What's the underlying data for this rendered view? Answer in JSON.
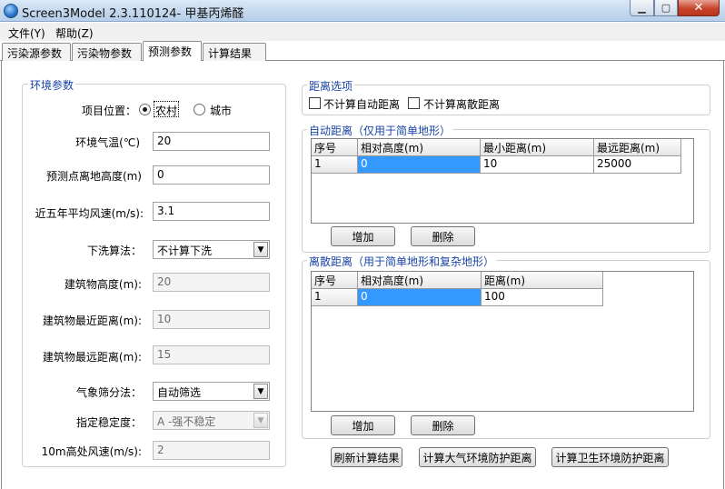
{
  "window": {
    "title": "Screen3Model 2.3.110124- 甲基丙烯醛",
    "min_glyph": "▁",
    "max_glyph": "▢",
    "close_glyph": "✕",
    "app_icon": "app-globe-icon"
  },
  "menu": {
    "file": "文件(Y)",
    "help": "帮助(Z)"
  },
  "tabs": [
    {
      "label": "污染源参数"
    },
    {
      "label": "污染物参数"
    },
    {
      "label": "预测参数",
      "active": true
    },
    {
      "label": "计算结果"
    }
  ],
  "env": {
    "group_title": "环境参数",
    "location_label": "项目位置：",
    "rural": "农村",
    "urban": "城市",
    "temp_label": "环境气温(℃)",
    "temp_value": "20",
    "height_label": "预测点离地高度(m)",
    "height_value": "0",
    "wind5_label": "近五年平均风速(m/s):",
    "wind5_value": "3.1",
    "downwash_label": "下洗算法：",
    "downwash_value": "不计算下洗",
    "bldg_height_label": "建筑物高度(m):",
    "bldg_height_value": "20",
    "bldg_near_label": "建筑物最近距离(m):",
    "bldg_near_value": "10",
    "bldg_far_label": "建筑物最远距离(m):",
    "bldg_far_value": "15",
    "met_label": "气象筛分法：",
    "met_value": "自动筛选",
    "stability_label": "指定稳定度：",
    "stability_value": "A -强不稳定",
    "wind10_label": "10m高处风速(m/s):",
    "wind10_value": "2"
  },
  "distance_options": {
    "title": "距离选项",
    "no_auto": "不计算自动距离",
    "no_discrete": "不计算离散距离"
  },
  "auto_distance": {
    "title": "自动距离（仅用于简单地形）",
    "columns": [
      "序号",
      "相对高度(m)",
      "最小距离(m)",
      "最远距离(m)"
    ],
    "rows": [
      [
        "1",
        "0",
        "10",
        "25000"
      ]
    ],
    "add": "增加",
    "delete": "删除"
  },
  "discrete_distance": {
    "title": "离散距离（用于简单地形和复杂地形）",
    "columns": [
      "序号",
      "相对高度(m)",
      "距离(m)"
    ],
    "rows": [
      [
        "1",
        "0",
        "100"
      ]
    ],
    "add": "增加",
    "delete": "删除"
  },
  "actions": {
    "refresh": "刷新计算结果",
    "air_protection": "计算大气环境防护距离",
    "hygiene_protection": "计算卫生环境防护距离"
  },
  "colors": {
    "selection": "#3399ff",
    "group_title": "#1a44a8"
  }
}
